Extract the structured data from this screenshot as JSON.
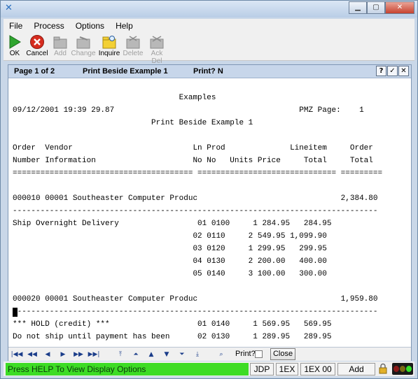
{
  "window": {
    "controls": [
      "minimize",
      "maximize",
      "close"
    ]
  },
  "menubar": {
    "items": [
      "File",
      "Process",
      "Options",
      "Help"
    ]
  },
  "toolbar": {
    "buttons": [
      {
        "label": "OK",
        "icon": "ok-play-icon"
      },
      {
        "label": "Cancel",
        "icon": "cancel-icon"
      },
      {
        "label": "Add",
        "icon": "add-folder-icon"
      },
      {
        "label": "Change",
        "icon": "change-folder-icon"
      },
      {
        "label": "Inquire",
        "icon": "inquire-folder-icon"
      },
      {
        "label": "Delete",
        "icon": "delete-folder-icon"
      },
      {
        "label": "Ack Del",
        "icon": "ack-delete-icon"
      }
    ]
  },
  "panel": {
    "page": "Page 1 of 2",
    "title": "Print Beside Example 1",
    "print_flag": "Print? N",
    "help_btn": "?",
    "ok_btn": "✓",
    "close_btn": "✕"
  },
  "report": {
    "lines": [
      "                                    Examples",
      "09/12/2001 19:39 29.87                                        PMZ Page:    1",
      "                              Print Beside Example 1",
      "",
      "Order  Vendor                          Ln Prod              Lineitem     Order",
      "Number Information                     No No   Units Price     Total     Total",
      "======================================= ============================== =========",
      "",
      "000010 00001 Southeaster Computer Produc                               2,384.80",
      "-------------------------------------------------------------------------------",
      "Ship Overnight Delivery                 01 0100     1 284.95   284.95",
      "                                       02 0110     2 549.95 1,099.90",
      "                                       03 0120     1 299.95   299.95",
      "                                       04 0130     2 200.00   400.00",
      "                                       05 0140     3 100.00   300.00",
      "",
      "000020 00001 Southeaster Computer Produc                               1,959.80",
      "-------------------------------------------------------------------------------",
      "*** HOLD (credit) ***                   01 0140     1 569.95   569.95",
      "Do not ship until payment has been      02 0130     1 289.95   289.95"
    ]
  },
  "navbar": {
    "print_label": "Print?",
    "close_label": "Close"
  },
  "status": {
    "message": "Press HELP To View Display Options",
    "fields": [
      "JDP",
      "1EX",
      "1EX 00",
      "Add"
    ]
  },
  "colors": {
    "status_bg": "#3ddc25",
    "panel_head": "#c7d6ea"
  }
}
